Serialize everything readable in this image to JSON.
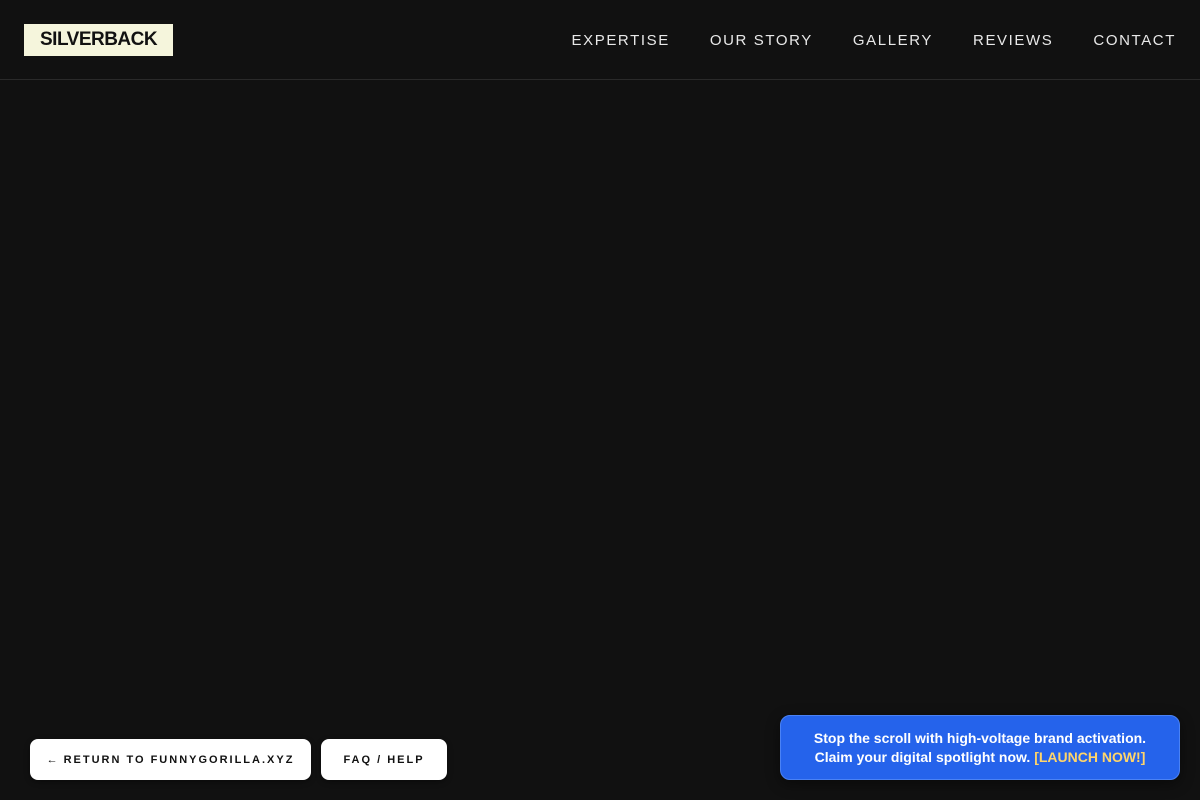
{
  "header": {
    "logo": "SILVERBACK",
    "nav": [
      {
        "label": "EXPERTISE"
      },
      {
        "label": "OUR STORY"
      },
      {
        "label": "GALLERY"
      },
      {
        "label": "REVIEWS"
      },
      {
        "label": "CONTACT"
      }
    ]
  },
  "footer": {
    "return_arrow": "←",
    "return_label": "RETURN TO FUNNYGORILLA.XYZ",
    "faq_label": "FAQ / HELP"
  },
  "promo": {
    "line1": "Stop the scroll with high-voltage brand activation.",
    "line2": "Claim your digital spotlight now.",
    "cta": "[LAUNCH NOW!]"
  },
  "colors": {
    "background": "#111111",
    "logo_bg": "#f5f5dc",
    "promo_bg": "#2563eb",
    "promo_cta": "#ffd56a"
  }
}
